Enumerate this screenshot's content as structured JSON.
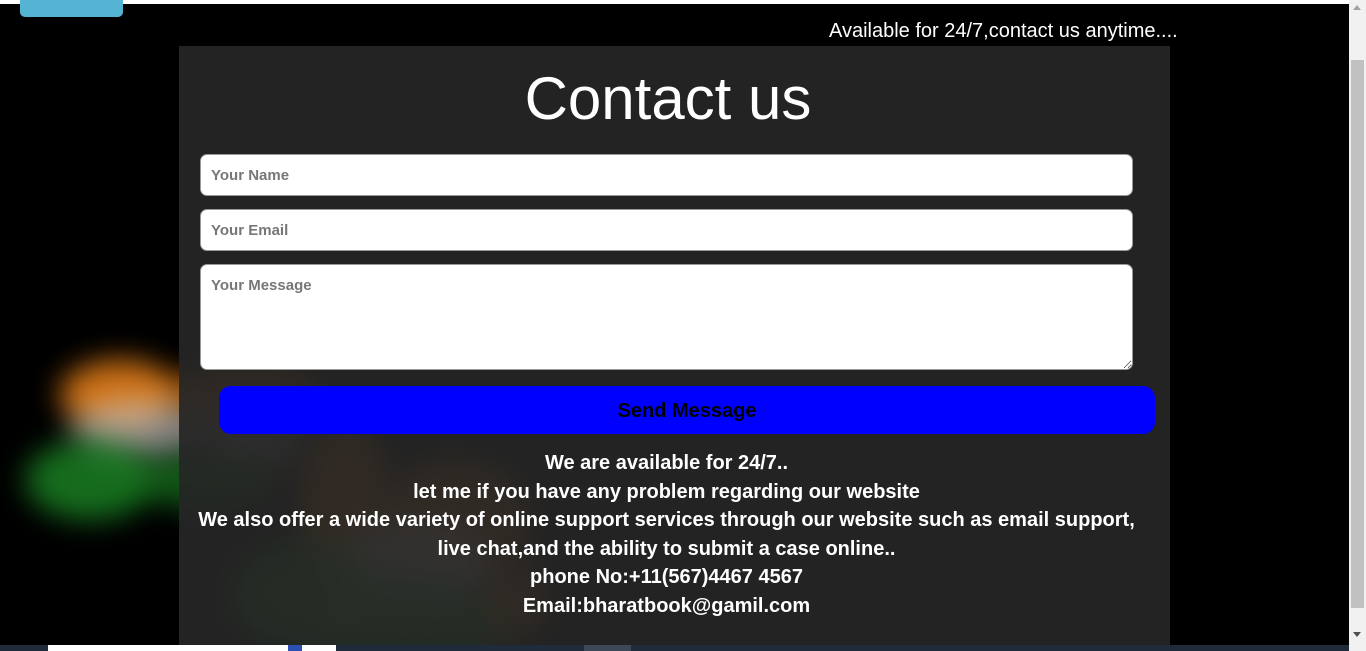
{
  "header": {
    "announcement": "Available for 24/7,contact us anytime...."
  },
  "contact": {
    "title": "Contact us",
    "name_placeholder": "Your Name",
    "email_placeholder": "Your Email",
    "message_placeholder": "Your Message",
    "send_label": "Send Message"
  },
  "info": {
    "lines": [
      "We are available for 24/7..",
      "let me if you have any problem regarding our website",
      "We also offer a wide variety of online support services through our website such as email support,",
      "live chat,and the ability to submit a case online..",
      "phone No:+11(567)4467 4567",
      "Email:bharatbook@gamil.com"
    ]
  },
  "colors": {
    "background": "#000000",
    "panel": "#262626",
    "send_button": "#0000ff",
    "tab_accent": "#55b4d4",
    "flag_saffron": "#ff8c1a",
    "flag_white": "#e6e6e6",
    "flag_green": "#1f9a2a"
  },
  "decor": {
    "background_image": "india-flag-smoke-graphic"
  }
}
